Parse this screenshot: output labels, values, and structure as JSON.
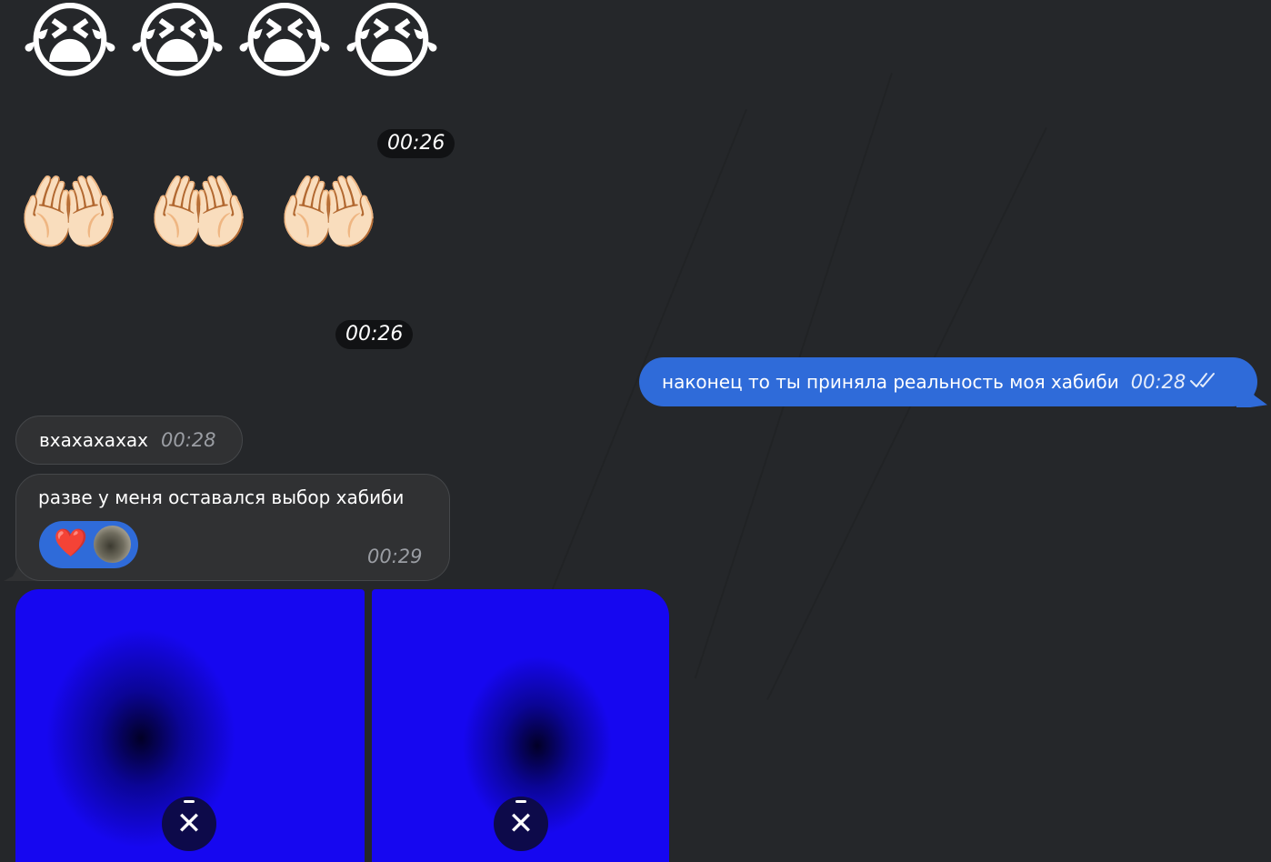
{
  "emoji_messages": [
    {
      "emojis": [
        "😭",
        "😭",
        "😭",
        "😭"
      ],
      "time": "00:26"
    },
    {
      "emojis": [
        "🤲🏻",
        "🤲🏻",
        "🤲🏻"
      ],
      "time": "00:26"
    }
  ],
  "outgoing_message": {
    "text": "наконец то ты приняла реальность моя хабиби",
    "time": "00:28",
    "status_icon": "double-check-icon"
  },
  "incoming_messages": [
    {
      "text": "вхахахахах",
      "time": "00:28"
    },
    {
      "text": "разве у меня оставался выбор хабиби",
      "time": "00:29",
      "reaction": {
        "emoji": "❤️",
        "icon": "heart-icon",
        "reactor": "user-avatar"
      }
    }
  ],
  "media": [
    {
      "action": "close-icon"
    },
    {
      "action": "close-icon"
    }
  ],
  "colors": {
    "background": "#25272a",
    "outgoing_bubble": "#2f6bd9",
    "incoming_bubble": "#303133",
    "time_pill": "#111214",
    "media_blue": "#1607f0"
  }
}
